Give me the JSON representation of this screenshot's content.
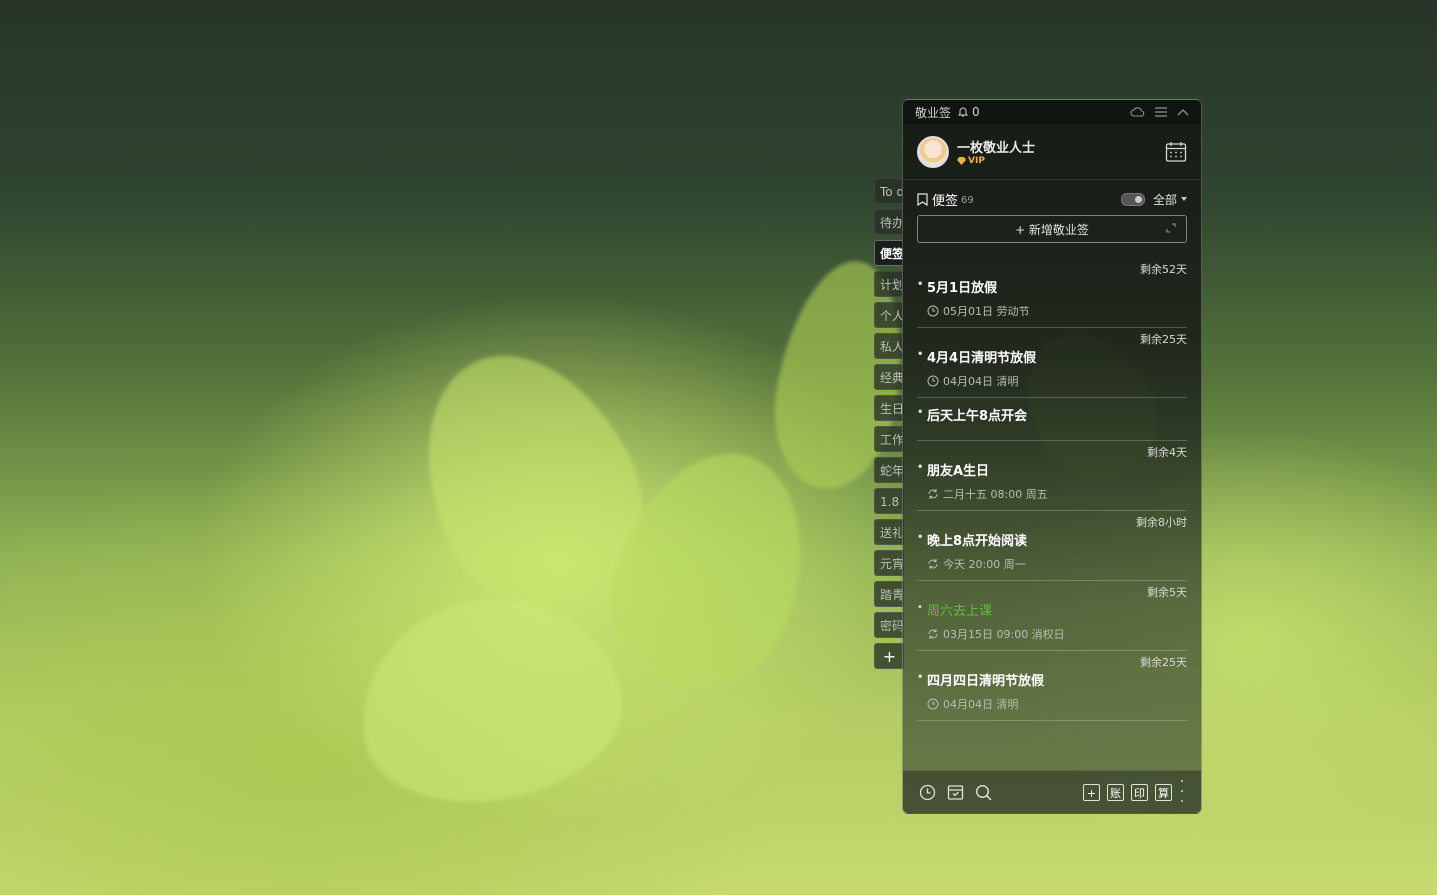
{
  "side_tabs": [
    "To d",
    "待办",
    "便签",
    "计划",
    "个人",
    "私人",
    "经典",
    "生日",
    "工作",
    "蛇年",
    "1.8",
    "送礼",
    "元宵",
    "踏青",
    "密码",
    "+"
  ],
  "active_tab_index": 2,
  "topbar": {
    "title": "敬业签",
    "notification_count": "0"
  },
  "profile": {
    "name": "一枚敬业人士",
    "badge": "VIP"
  },
  "notes_header": {
    "label": "便签",
    "count": "69",
    "filter": "全部"
  },
  "new_note_label": "+ 新增敬业签",
  "notes": [
    {
      "remain": "剩余52天",
      "title": "5月1日放假",
      "meta": "05月01日 劳动节",
      "icon": "clock-icon"
    },
    {
      "remain": "剩余25天",
      "title": "4月4日清明节放假",
      "meta": "04月04日 清明",
      "icon": "clock-icon"
    },
    {
      "remain": "",
      "title": "后天上午8点开会",
      "meta": "",
      "icon": ""
    },
    {
      "remain": "剩余4天",
      "title": "朋友A生日",
      "meta": "二月十五 08:00 周五",
      "icon": "repeat-icon"
    },
    {
      "remain": "剩余8小时",
      "title": "晚上8点开始阅读",
      "meta": "今天 20:00 周一",
      "icon": "repeat-icon"
    },
    {
      "remain": "剩余5天",
      "title": "周六去上课",
      "meta": "03月15日 09:00 消权日",
      "icon": "repeat-icon",
      "green": true
    },
    {
      "remain": "剩余25天",
      "title": "四月四日清明节放假",
      "meta": "04月04日 清明",
      "icon": "clock-icon"
    }
  ],
  "bottom_buttons": [
    "+",
    "账",
    "印",
    "算"
  ],
  "colors": {
    "accent_green": "#5fbf3a",
    "vip_gold": "#f0b13c"
  }
}
